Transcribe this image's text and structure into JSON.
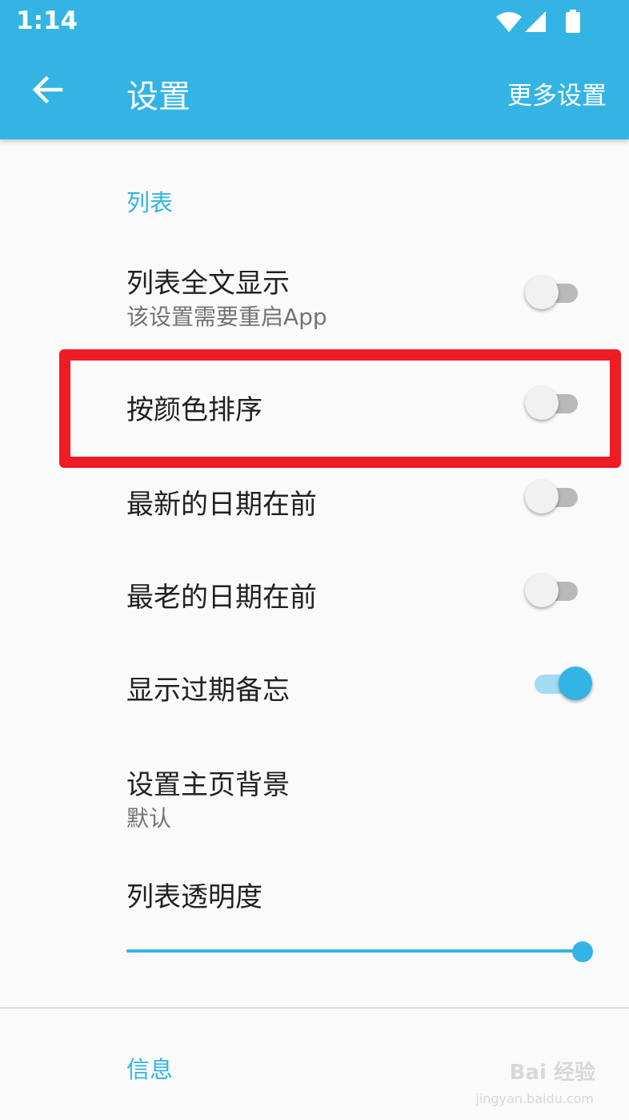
{
  "status_bar": {
    "time": "1:14",
    "icons": [
      "wifi-icon",
      "signal-icon",
      "battery-icon"
    ]
  },
  "toolbar": {
    "title": "设置",
    "more_label": "更多设置",
    "back_icon": "arrow-back-icon"
  },
  "colors": {
    "accent": "#33b4e5",
    "highlight": "#ee1c25"
  },
  "section_list": {
    "header": "列表",
    "items": [
      {
        "title": "列表全文显示",
        "subtitle": "该设置需要重启App",
        "checked": false
      },
      {
        "title": "按颜色排序",
        "checked": false,
        "highlighted": true
      },
      {
        "title": "最新的日期在前",
        "checked": false
      },
      {
        "title": "最老的日期在前",
        "checked": false
      },
      {
        "title": "显示过期备忘",
        "checked": true
      }
    ],
    "background": {
      "title": "设置主页背景",
      "subtitle": "默认"
    },
    "transparency": {
      "title": "列表透明度",
      "value_fraction": 1.0
    }
  },
  "section_info": {
    "header": "信息"
  },
  "watermark": {
    "text": "Bai 经验",
    "sub": "jingyan.baidu.com"
  }
}
